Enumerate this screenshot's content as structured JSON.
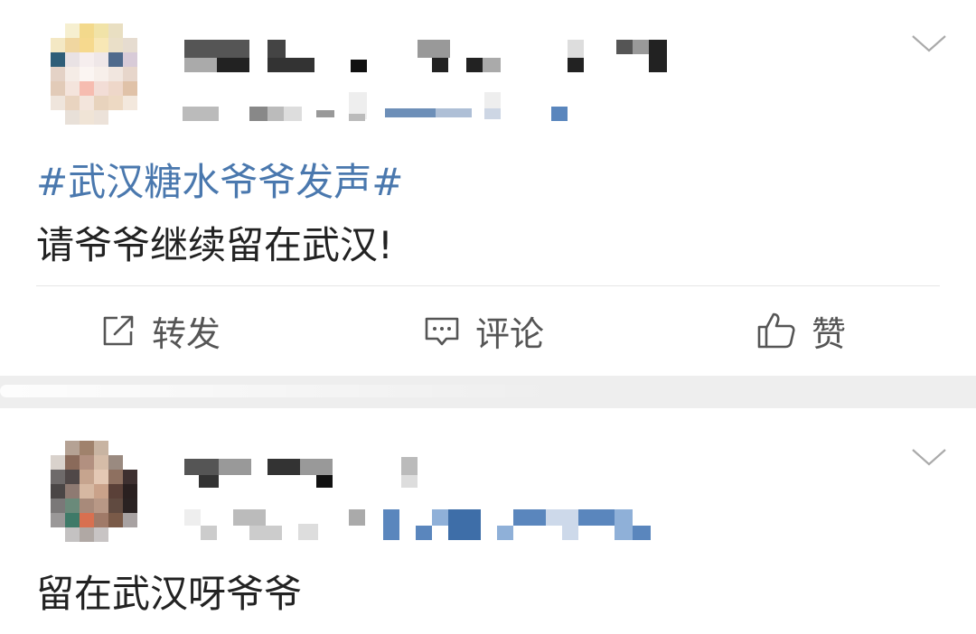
{
  "feed": {
    "posts": [
      {
        "hashtag": "#武汉糖水爷爷发声#",
        "text": "请爷爷继续留在武汉!",
        "actions": {
          "repost": "转发",
          "comment": "评论",
          "like": "赞"
        }
      },
      {
        "text": "留在武汉呀爷爷"
      }
    ]
  },
  "icons": {
    "menu": "chevron-down-icon",
    "repost": "share-square-icon",
    "comment": "comment-bubble-icon",
    "like": "thumbs-up-icon"
  },
  "colors": {
    "hashtag": "#4a78ae",
    "body_text": "#222222",
    "action_text": "#555555",
    "separator": "#eeeeee"
  }
}
